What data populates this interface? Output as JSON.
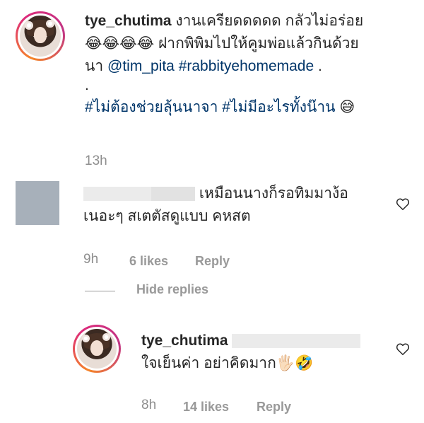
{
  "main_comment": {
    "username": "tye_chutima",
    "line1_text": "งานเครียดดดดด กลัวไม่อร่อย",
    "emoji_row": "😂😂😂😂",
    "line2_text": "ฝากพิพิมไปให้คูมพ่อแล้วกินด้วย",
    "line3_prefix": "นา",
    "mention": "@tim_pita",
    "hashtag1": "#rabbityehomemade",
    "line3_suffix": ".",
    "dot_line": ".",
    "hashtag2": "#ไม่ต้องช่วยลุ้นนาจา",
    "hashtag3": "#ไม่มีอะไรทั้งน๊าน",
    "end_emoji": "😅",
    "time": "13h"
  },
  "comment2": {
    "text_line1": "เหมือนนางก็รอทิมมาง้อ",
    "text_line2": "เนอะๆ สเตตัสดูแบบ คหสต",
    "time": "9h",
    "likes": "6 likes",
    "reply_label": "Reply"
  },
  "replies_toggle": {
    "label": "Hide replies"
  },
  "reply": {
    "username": "tye_chutima",
    "text": "ใจเย็นค่า อย่าคิดมาก",
    "emoji": "🖐🏻🤣",
    "time": "8h",
    "likes": "14 likes",
    "reply_label": "Reply"
  },
  "colors": {
    "link": "#003569",
    "meta": "#999999",
    "avatar_placeholder": "#a7b0ba"
  },
  "icons": [
    "heart-icon",
    "heart-icon"
  ]
}
